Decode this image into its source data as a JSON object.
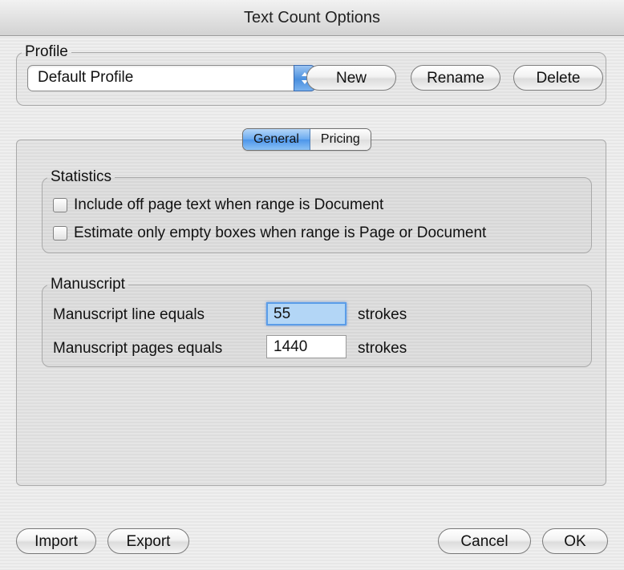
{
  "window": {
    "title": "Text Count Options"
  },
  "profile": {
    "legend": "Profile",
    "selected": "Default Profile",
    "new_label": "New",
    "rename_label": "Rename",
    "delete_label": "Delete"
  },
  "tabs": [
    {
      "label": "General",
      "selected": true
    },
    {
      "label": "Pricing",
      "selected": false
    }
  ],
  "statistics": {
    "legend": "Statistics",
    "options": [
      {
        "label": "Include off page text when range is Document",
        "checked": false
      },
      {
        "label": "Estimate only empty boxes when range is Page or Document",
        "checked": false
      }
    ]
  },
  "manuscript": {
    "legend": "Manuscript",
    "rows": [
      {
        "label": "Manuscript line equals",
        "value": "55",
        "unit": "strokes"
      },
      {
        "label": "Manuscript pages equals",
        "value": "1440",
        "unit": "strokes"
      }
    ]
  },
  "footer": {
    "import_label": "Import",
    "export_label": "Export",
    "cancel_label": "Cancel",
    "ok_label": "OK"
  },
  "colors": {
    "accent": "#4b95ea",
    "focus_field": "#b3d6f6"
  }
}
